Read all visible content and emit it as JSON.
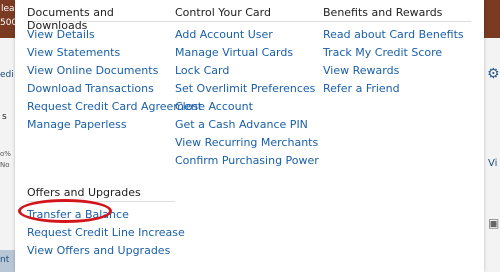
{
  "background": {
    "left_fragments": [
      "lea",
      "500",
      "edi",
      "s",
      "o%",
      "No",
      "nt"
    ],
    "right_fragments": [
      "⚙",
      "Vi",
      "▣"
    ]
  },
  "menu": {
    "documents": {
      "heading": "Documents and Downloads",
      "items": [
        "View Details",
        "View Statements",
        "View Online Documents",
        "Download Transactions",
        "Request Credit Card Agreement",
        "Manage Paperless"
      ]
    },
    "control": {
      "heading": "Control Your Card",
      "items": [
        "Add Account User",
        "Manage Virtual Cards",
        "Lock Card",
        "Set Overlimit Preferences",
        "Close Account",
        "Get a Cash Advance PIN",
        "View Recurring Merchants",
        "Confirm Purchasing Power"
      ]
    },
    "benefits": {
      "heading": "Benefits and Rewards",
      "items": [
        "Read about Card Benefits",
        "Track My Credit Score",
        "View Rewards",
        "Refer a Friend"
      ]
    },
    "offers": {
      "heading": "Offers and Upgrades",
      "items": [
        "Transfer a Balance",
        "Request Credit Line Increase",
        "View Offers and Upgrades"
      ]
    }
  },
  "colors": {
    "link": "#1a5fa8",
    "heading": "#222222",
    "highlight": "#d3151b"
  }
}
